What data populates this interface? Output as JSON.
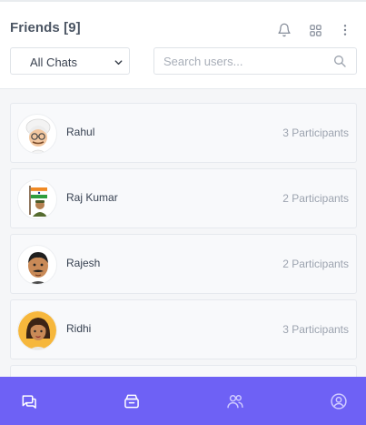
{
  "header": {
    "title": "Friends [9]",
    "icons": [
      "bell-icon",
      "grid-icon",
      "more-vertical-icon"
    ]
  },
  "filter": {
    "selected": "All Chats"
  },
  "search": {
    "placeholder": "Search users..."
  },
  "friends": [
    {
      "name": "Rahul",
      "participants": "3 Participants",
      "avatar": "avatar-turban-glasses"
    },
    {
      "name": "Raj Kumar",
      "participants": "2 Participants",
      "avatar": "avatar-flag-soldier"
    },
    {
      "name": "Rajesh",
      "participants": "2 Participants",
      "avatar": "avatar-mustache-man"
    },
    {
      "name": "Ridhi",
      "participants": "3 Participants",
      "avatar": "avatar-woman"
    }
  ],
  "bottom_nav": {
    "items": [
      "chats-icon",
      "archive-icon",
      "users-icon",
      "profile-icon"
    ]
  },
  "colors": {
    "accent": "#6e61f5",
    "nav_icon": "#ffffff"
  }
}
